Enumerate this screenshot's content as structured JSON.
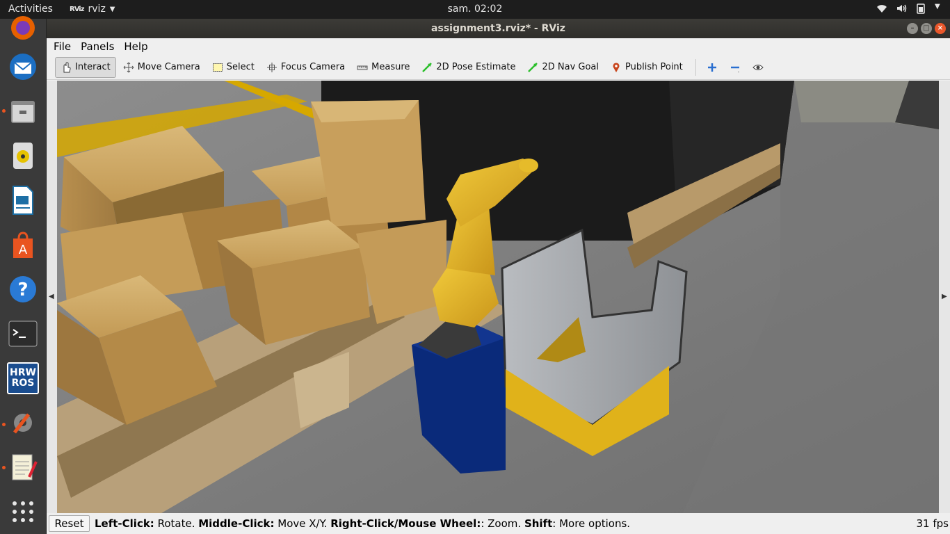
{
  "topbar": {
    "activities": "Activities",
    "app_icon_text": "RViz",
    "app_name": "rviz",
    "clock": "sam. 02:02"
  },
  "window": {
    "title": "assignment3.rviz* - RViz"
  },
  "menu": {
    "file": "File",
    "panels": "Panels",
    "help": "Help"
  },
  "toolbar": {
    "interact": "Interact",
    "move_camera": "Move Camera",
    "select": "Select",
    "focus_camera": "Focus Camera",
    "measure": "Measure",
    "pose_estimate": "2D Pose Estimate",
    "nav_goal": "2D Nav Goal",
    "publish_point": "Publish Point"
  },
  "dock": {
    "hrw_line1": "HRW",
    "hrw_line2": "ROS"
  },
  "status": {
    "reset": "Reset",
    "left_click_key": "Left-Click:",
    "left_click_val": " Rotate. ",
    "middle_click_key": "Middle-Click:",
    "middle_click_val": " Move X/Y. ",
    "right_click_key": "Right-Click/Mouse Wheel:",
    "right_click_val": ": Zoom. ",
    "shift_key": "Shift",
    "shift_val": ": More options.",
    "fps": "31 fps"
  },
  "colors": {
    "accent": "#e95420",
    "robot_yellow": "#e3b21c",
    "pedestal_blue": "#0a2a7a",
    "box_cardboard": "#c9a25e"
  }
}
